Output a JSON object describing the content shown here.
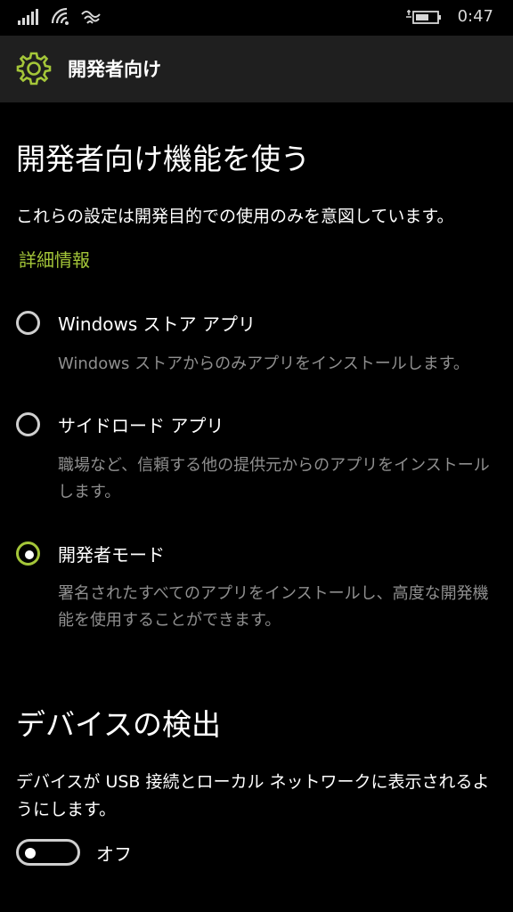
{
  "status_bar": {
    "time": "0:47",
    "icons": [
      "signal-icon",
      "wifi-icon",
      "wifi-call-icon",
      "battery-charging-icon"
    ]
  },
  "header": {
    "title": "開発者向け",
    "icon": "gear-icon"
  },
  "dev_features": {
    "title": "開発者向け機能を使う",
    "description": "これらの設定は開発目的での使用のみを意図しています。",
    "link": "詳細情報",
    "options": [
      {
        "label": "Windows ストア アプリ",
        "description": "Windows ストアからのみアプリをインストールします。",
        "selected": false
      },
      {
        "label": "サイドロード アプリ",
        "description": "職場など、信頼する他の提供元からのアプリをインストールします。",
        "selected": false
      },
      {
        "label": "開発者モード",
        "description": "署名されたすべてのアプリをインストールし、高度な開発機能を使用することができます。",
        "selected": true
      }
    ]
  },
  "device_discovery": {
    "title": "デバイスの検出",
    "description": "デバイスが USB 接続とローカル ネットワークに表示されるようにします。",
    "toggle_label": "オフ",
    "toggle_on": false
  },
  "colors": {
    "accent": "#a4c639",
    "background": "#000000",
    "header_bg": "#1f1f1f",
    "secondary_text": "#8f8f8f"
  }
}
